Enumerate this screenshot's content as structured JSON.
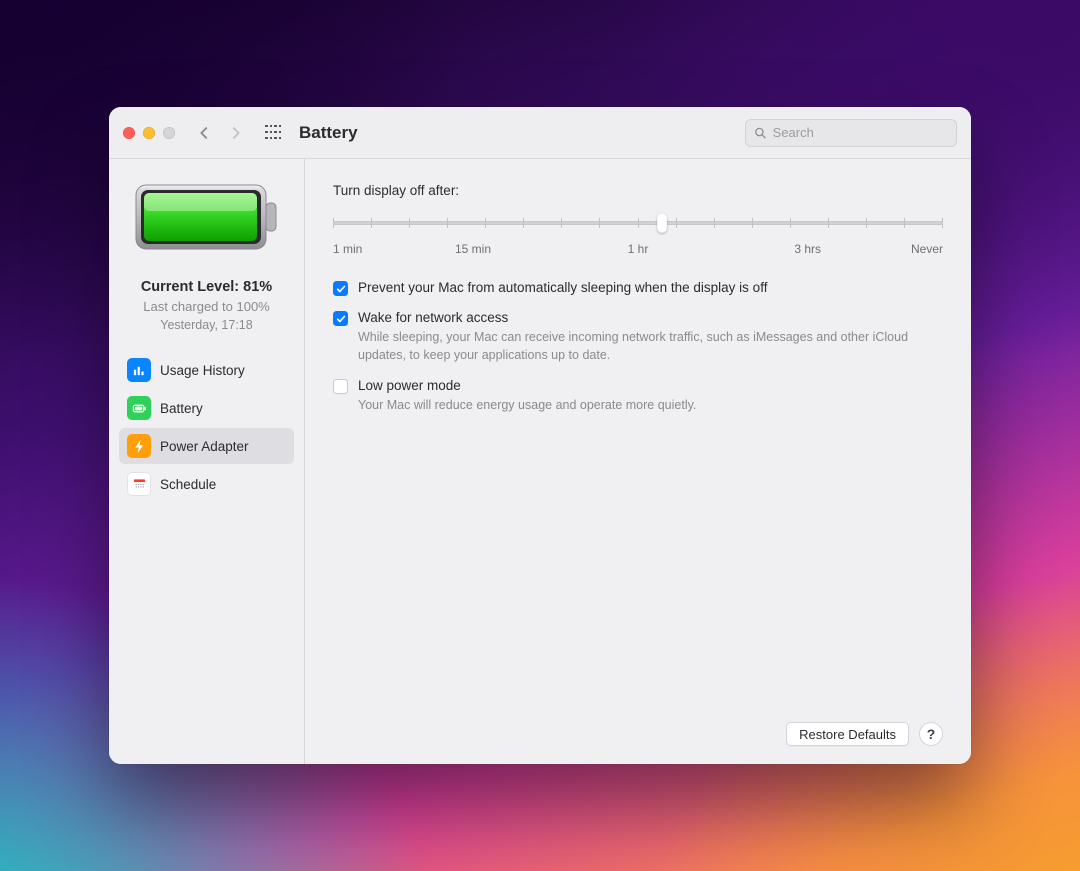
{
  "toolbar": {
    "title": "Battery",
    "search_placeholder": "Search"
  },
  "sidebar": {
    "status": {
      "level_label": "Current Level: 81%",
      "last_charged": "Last charged to 100%",
      "timestamp": "Yesterday, 17:18"
    },
    "items": [
      {
        "label": "Usage History",
        "icon": "chart-bar-icon",
        "color": "blue",
        "selected": false
      },
      {
        "label": "Battery",
        "icon": "battery-icon",
        "color": "green",
        "selected": false
      },
      {
        "label": "Power Adapter",
        "icon": "bolt-icon",
        "color": "orange",
        "selected": true
      },
      {
        "label": "Schedule",
        "icon": "calendar-icon",
        "color": "white",
        "selected": false
      }
    ]
  },
  "main": {
    "slider": {
      "heading": "Turn display off after:",
      "thumb_pct": 54,
      "ticks": 17,
      "labels": {
        "l0": "1 min",
        "l1": "15 min",
        "l2": "1 hr",
        "l3": "3 hrs",
        "l4": "Never"
      }
    },
    "options": [
      {
        "label": "Prevent your Mac from automatically sleeping when the display is off",
        "desc": "",
        "checked": true
      },
      {
        "label": "Wake for network access",
        "desc": "While sleeping, your Mac can receive incoming network traffic, such as iMessages and other iCloud updates, to keep your applications up to date.",
        "checked": true
      },
      {
        "label": "Low power mode",
        "desc": "Your Mac will reduce energy usage and operate more quietly.",
        "checked": false
      }
    ],
    "footer": {
      "restore_label": "Restore Defaults",
      "help_label": "?"
    }
  }
}
